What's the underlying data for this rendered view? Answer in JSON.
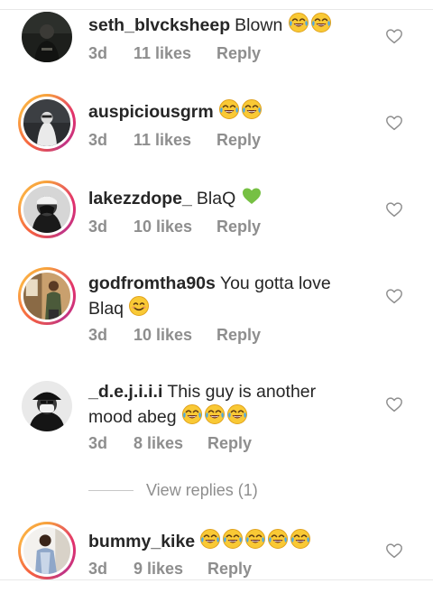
{
  "comments": [
    {
      "username": "seth_blvcksheep",
      "text": "Blown",
      "emoji_count": 2,
      "emoji_name": "face-with-tears-of-joy-icon",
      "emoji_after": "",
      "time": "3d",
      "likes": "11 likes",
      "reply": "Reply",
      "avatar_ring": false
    },
    {
      "username": "auspiciousgrm",
      "text": "",
      "emoji_count": 2,
      "emoji_name": "face-with-tears-of-joy-icon",
      "emoji_after": "",
      "time": "3d",
      "likes": "11 likes",
      "reply": "Reply",
      "avatar_ring": true
    },
    {
      "username": "lakezzdope_",
      "text": "BlaQ",
      "emoji_count": 0,
      "emoji_name": "",
      "emoji_after": "green-heart-icon",
      "time": "3d",
      "likes": "10 likes",
      "reply": "Reply",
      "avatar_ring": true
    },
    {
      "username": "godfromtha90s",
      "text": "You gotta love Blaq",
      "emoji_count": 0,
      "emoji_name": "",
      "emoji_after": "smiling-face-icon",
      "time": "3d",
      "likes": "10 likes",
      "reply": "Reply",
      "avatar_ring": true
    },
    {
      "username": "_d.e.j.i.i.i",
      "text": "This guy is another mood abeg",
      "emoji_count": 3,
      "emoji_name": "face-with-tears-of-joy-icon",
      "emoji_after": "",
      "time": "3d",
      "likes": "8 likes",
      "reply": "Reply",
      "avatar_ring": false
    },
    {
      "username": "bummy_kike",
      "text": "",
      "emoji_count": 5,
      "emoji_name": "face-with-tears-of-joy-icon",
      "emoji_after": "",
      "time": "3d",
      "likes": "9 likes",
      "reply": "Reply",
      "avatar_ring": true
    }
  ],
  "view_replies": "View replies (1)",
  "colors": {
    "text": "#262626",
    "meta": "#8e8e8e",
    "ring_start": "#f7a23c",
    "ring_end": "#c13584"
  }
}
